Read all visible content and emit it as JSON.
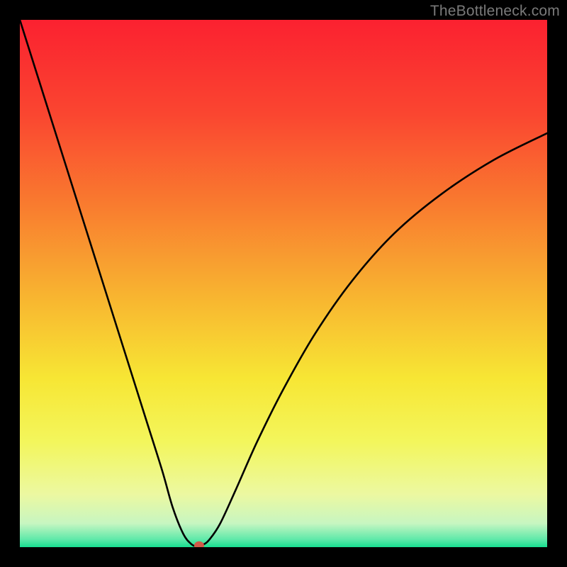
{
  "watermark": "TheBottleneck.com",
  "chart_data": {
    "type": "line",
    "title": "",
    "xlabel": "",
    "ylabel": "",
    "xlim": [
      0,
      100
    ],
    "ylim": [
      0,
      100
    ],
    "grid": false,
    "background_gradient": {
      "stops": [
        {
          "offset": 0.0,
          "color": "#fb2130"
        },
        {
          "offset": 0.18,
          "color": "#fa4630"
        },
        {
          "offset": 0.35,
          "color": "#f97b2f"
        },
        {
          "offset": 0.52,
          "color": "#f8b330"
        },
        {
          "offset": 0.68,
          "color": "#f7e634"
        },
        {
          "offset": 0.8,
          "color": "#f3f65c"
        },
        {
          "offset": 0.9,
          "color": "#ecf8a1"
        },
        {
          "offset": 0.955,
          "color": "#c7f6c1"
        },
        {
          "offset": 0.985,
          "color": "#60e9aa"
        },
        {
          "offset": 1.0,
          "color": "#16df90"
        }
      ]
    },
    "series": [
      {
        "name": "bottleneck-curve",
        "x": [
          0,
          3,
          6,
          9,
          12,
          15,
          18,
          21,
          24,
          27,
          29,
          31,
          32.5,
          33.5,
          34.8,
          36,
          38,
          41,
          45,
          50,
          56,
          63,
          71,
          80,
          90,
          100
        ],
        "y": [
          100,
          90.5,
          81,
          71.5,
          62,
          52.5,
          43,
          33.5,
          24,
          14.5,
          7.5,
          2.5,
          0.6,
          0.2,
          0.5,
          1.5,
          4.5,
          11,
          20,
          30,
          40.5,
          50.5,
          59.5,
          67,
          73.5,
          78.5
        ]
      }
    ],
    "marker": {
      "x": 34,
      "y": 0.3,
      "color": "#d15a49",
      "rx": 7,
      "ry": 6
    }
  }
}
